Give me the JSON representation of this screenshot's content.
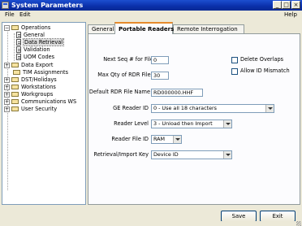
{
  "window": {
    "title": "System Parameters",
    "controls": {
      "minimize": "_",
      "maximize": "□",
      "close": "×"
    }
  },
  "menu": {
    "file": "File",
    "edit": "Edit",
    "help": "Help"
  },
  "tree": {
    "items": [
      {
        "label": "Operations",
        "icon": "folder-icon",
        "expander": "−"
      },
      {
        "label": "General",
        "icon": "doc-icon"
      },
      {
        "label": "Data Retrieval",
        "icon": "doc-icon",
        "selected": true
      },
      {
        "label": "Validation",
        "icon": "doc-icon"
      },
      {
        "label": "UOM Codes",
        "icon": "doc-icon"
      },
      {
        "label": "Data Export",
        "icon": "folder-icon",
        "expander": "+"
      },
      {
        "label": "TIM Assignments",
        "icon": "folder-icon"
      },
      {
        "label": "DST/Holidays",
        "icon": "folder-icon",
        "expander": "+"
      },
      {
        "label": "Workstations",
        "icon": "folder-icon",
        "expander": "+"
      },
      {
        "label": "Workgroups",
        "icon": "folder-icon",
        "expander": "+"
      },
      {
        "label": "Communications WS",
        "icon": "folder-icon",
        "expander": "+"
      },
      {
        "label": "User Security",
        "icon": "folder-icon",
        "expander": "+"
      }
    ]
  },
  "tabs": [
    {
      "label": "General",
      "active": false
    },
    {
      "label": "Portable Readers",
      "active": true
    },
    {
      "label": "Remote Interrogation",
      "active": false
    }
  ],
  "form": {
    "next_seq": {
      "label": "Next Seq # for File",
      "value": "0"
    },
    "max_qty": {
      "label": "Max Qty of RDR Files",
      "value": "30"
    },
    "default_rdr": {
      "label": "Default RDR File Name",
      "value": "RD000000.HHF"
    },
    "ge_reader_id": {
      "label": "GE Reader ID",
      "value": "0 - Use all 18 characters"
    },
    "reader_level": {
      "label": "Reader Level",
      "value": "3 - Unload then Import"
    },
    "reader_file_id": {
      "label": "Reader File ID",
      "value": "RAM"
    },
    "retrieval_key": {
      "label": "Retrieval/Import Key",
      "value": "Device ID"
    },
    "delete_overlaps": {
      "label": "Delete Overlaps",
      "checked": false
    },
    "allow_id_mismatch": {
      "label": "Allow ID Mismatch",
      "checked": false
    }
  },
  "buttons": {
    "save": "Save",
    "exit": "Exit"
  }
}
